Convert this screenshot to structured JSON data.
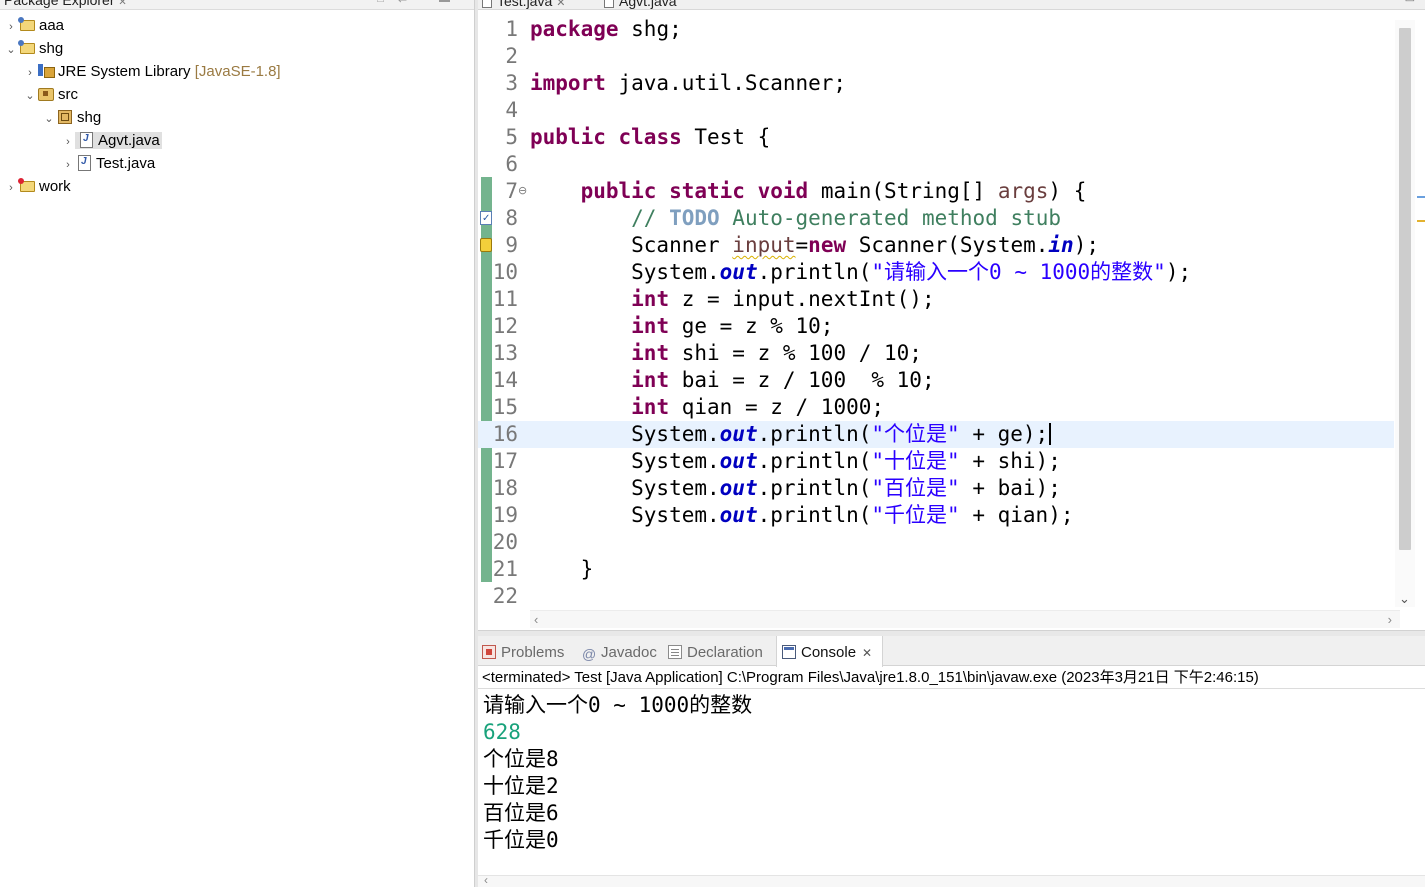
{
  "explorer": {
    "title": "Package Explorer",
    "title_close": "✕",
    "tree": [
      {
        "label": "aaa",
        "suffix": "",
        "twisty": "›"
      },
      {
        "label": "shg",
        "suffix": "",
        "twisty": "⌄"
      },
      {
        "label": "JRE System Library",
        "suffix": "[JavaSE-1.8]",
        "twisty": "›"
      },
      {
        "label": "src",
        "suffix": "",
        "twisty": "⌄"
      },
      {
        "label": "shg",
        "suffix": "",
        "twisty": "⌄"
      },
      {
        "label": "Agvt.java",
        "suffix": "",
        "twisty": "›"
      },
      {
        "label": "Test.java",
        "suffix": "",
        "twisty": "›"
      },
      {
        "label": "work",
        "suffix": "",
        "twisty": "›"
      }
    ]
  },
  "editor": {
    "tabs": [
      {
        "label": "Test.java",
        "close": "✕"
      },
      {
        "label": "Agvt.java"
      }
    ],
    "line_numbers": [
      "1",
      "2",
      "3",
      "4",
      "5",
      "6",
      "7",
      "8",
      "9",
      "10",
      "11",
      "12",
      "13",
      "14",
      "15",
      "16",
      "17",
      "18",
      "19",
      "20",
      "21",
      "22"
    ],
    "fold_marker": "⊖",
    "code": {
      "l1_kw": "package",
      "l1_rest": " shg;",
      "l3_kw": "import",
      "l3_rest": " java.util.Scanner;",
      "l5_kw1": "public",
      "l5_kw2": "class",
      "l5_rest": " Test {",
      "l7_indent": "    ",
      "l7_kw1": "public",
      "l7_kw2": "static",
      "l7_kw3": "void",
      "l7_a": " main(String[] ",
      "l7_var": "args",
      "l7_b": ") {",
      "l8_comment_a": "        // ",
      "l8_todo": "TODO",
      "l8_comment_b": " Auto-generated method stub",
      "l9_a": "        Scanner ",
      "l9_var": "input",
      "l9_b": "=",
      "l9_kw": "new",
      "l9_c": " Scanner(System.",
      "l9_fld": "in",
      "l9_d": ");",
      "l10_a": "        System.",
      "l10_fld": "out",
      "l10_b": ".println(",
      "l10_str": "\"请输入一个0 ~ 1000的整数\"",
      "l10_c": ");",
      "l11_a": "        ",
      "l11_kw": "int",
      "l11_b": " z = input.nextInt();",
      "l12_a": "        ",
      "l12_kw": "int",
      "l12_b": " ge = z % 10;",
      "l13_a": "        ",
      "l13_kw": "int",
      "l13_b": " shi = z % 100 / 10;",
      "l14_a": "        ",
      "l14_kw": "int",
      "l14_b": " bai = z / 100  % 10;",
      "l15_a": "        ",
      "l15_kw": "int",
      "l15_b": " qian = z / 1000;",
      "l16_a": "        System.",
      "l16_fld": "out",
      "l16_b": ".println(",
      "l16_str": "\"个位是\"",
      "l16_c": " + ge);",
      "l17_a": "        System.",
      "l17_fld": "out",
      "l17_b": ".println(",
      "l17_str": "\"十位是\"",
      "l17_c": " + shi);",
      "l18_a": "        System.",
      "l18_fld": "out",
      "l18_b": ".println(",
      "l18_str": "\"百位是\"",
      "l18_c": " + bai);",
      "l19_a": "        System.",
      "l19_fld": "out",
      "l19_b": ".println(",
      "l19_str": "\"千位是\"",
      "l19_c": " + qian);",
      "l21": "    }"
    }
  },
  "bottom": {
    "tabs": [
      {
        "label": "Problems"
      },
      {
        "label": "Javadoc"
      },
      {
        "label": "Declaration"
      },
      {
        "label": "Console",
        "close": "✕"
      }
    ],
    "status": "<terminated> Test [Java Application] C:\\Program Files\\Java\\jre1.8.0_151\\bin\\javaw.exe (2023年3月21日 下午2:46:15)",
    "output": {
      "prompt_a": "请输入一个",
      "prompt_b": "0 ~ 1000",
      "prompt_c": "的整数",
      "input": "628",
      "ge_label": "个位是",
      "ge_value": "8",
      "shi_label": "十位是",
      "shi_value": "2",
      "bai_label": "百位是",
      "bai_value": "6",
      "qian_label": "千位是",
      "qian_value": "0"
    }
  },
  "colors": {
    "keyword": "#7f0055",
    "comment": "#3f7f5f",
    "string": "#2a00ff",
    "field": "#0000c0",
    "console_input": "#19a27b",
    "current_line": "#e8f2fe"
  }
}
